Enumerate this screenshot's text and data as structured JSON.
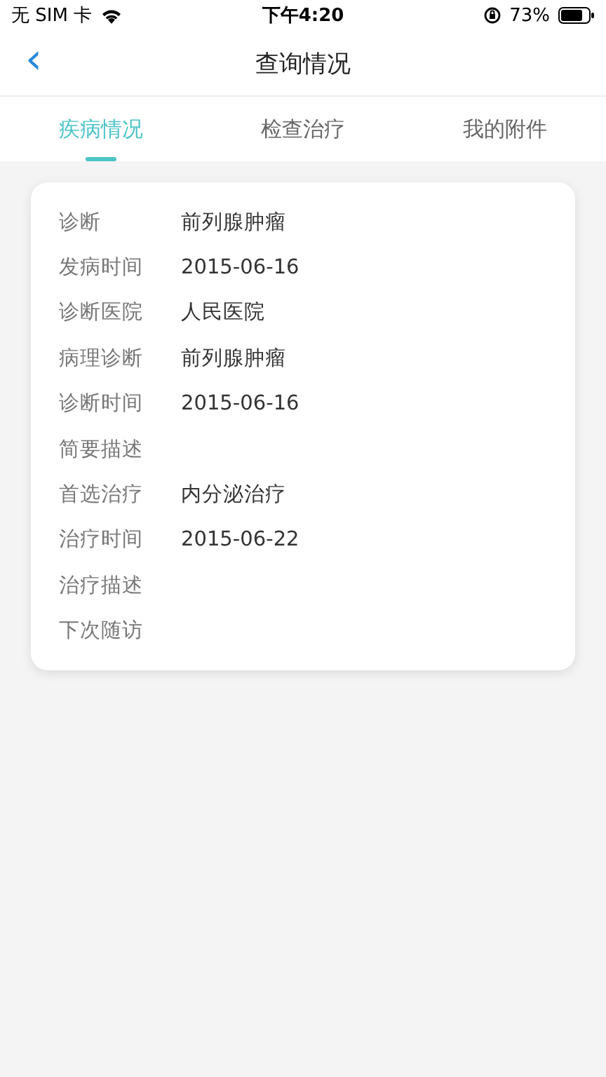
{
  "status_bar": {
    "carrier": "无 SIM 卡",
    "time": "下午4:20",
    "battery": "73%"
  },
  "nav": {
    "back": "‹",
    "title": "查询情况"
  },
  "tabs": [
    {
      "label": "疾病情况",
      "selected": true
    },
    {
      "label": "检查治疗",
      "selected": false
    },
    {
      "label": "我的附件",
      "selected": false
    }
  ],
  "fields": [
    {
      "label": "诊断",
      "value": "前列腺肿瘤"
    },
    {
      "label": "发病时间",
      "value": "2015-06-16"
    },
    {
      "label": "诊断医院",
      "value": "人民医院"
    },
    {
      "label": "病理诊断",
      "value": "前列腺肿瘤"
    },
    {
      "label": "诊断时间",
      "value": "2015-06-16"
    },
    {
      "label": "简要描述"
    },
    {
      "label": "首选治疗",
      "value": "内分泌治疗"
    },
    {
      "label": "治疗时间",
      "value": "2015-06-22"
    },
    {
      "label": "治疗描述"
    },
    {
      "label": "下次随访"
    }
  ]
}
